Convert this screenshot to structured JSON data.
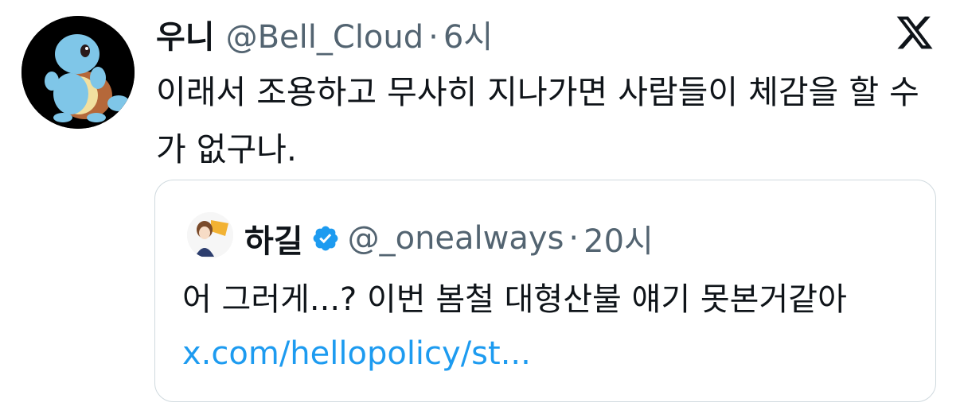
{
  "tweet": {
    "name": "우니",
    "handle": "@Bell_Cloud",
    "separator": "·",
    "time": "6시",
    "text": "이래서 조용하고 무사히 지나가면 사람들이 체감을 할 수가 없구나."
  },
  "quoted": {
    "name": "하길",
    "handle": "@_onealways",
    "separator": "·",
    "time": "20시",
    "text": "어 그러게...? 이번 봄철 대형산불 얘기 못본거같아",
    "link": "x.com/hellopolicy/st..."
  },
  "icons": {
    "brand": "x-logo-icon",
    "verified": "verified-badge-icon"
  },
  "colors": {
    "link": "#1d9bf0",
    "secondary_text": "#536471",
    "verified": "#1d9bf0",
    "border": "#cfd9de"
  }
}
